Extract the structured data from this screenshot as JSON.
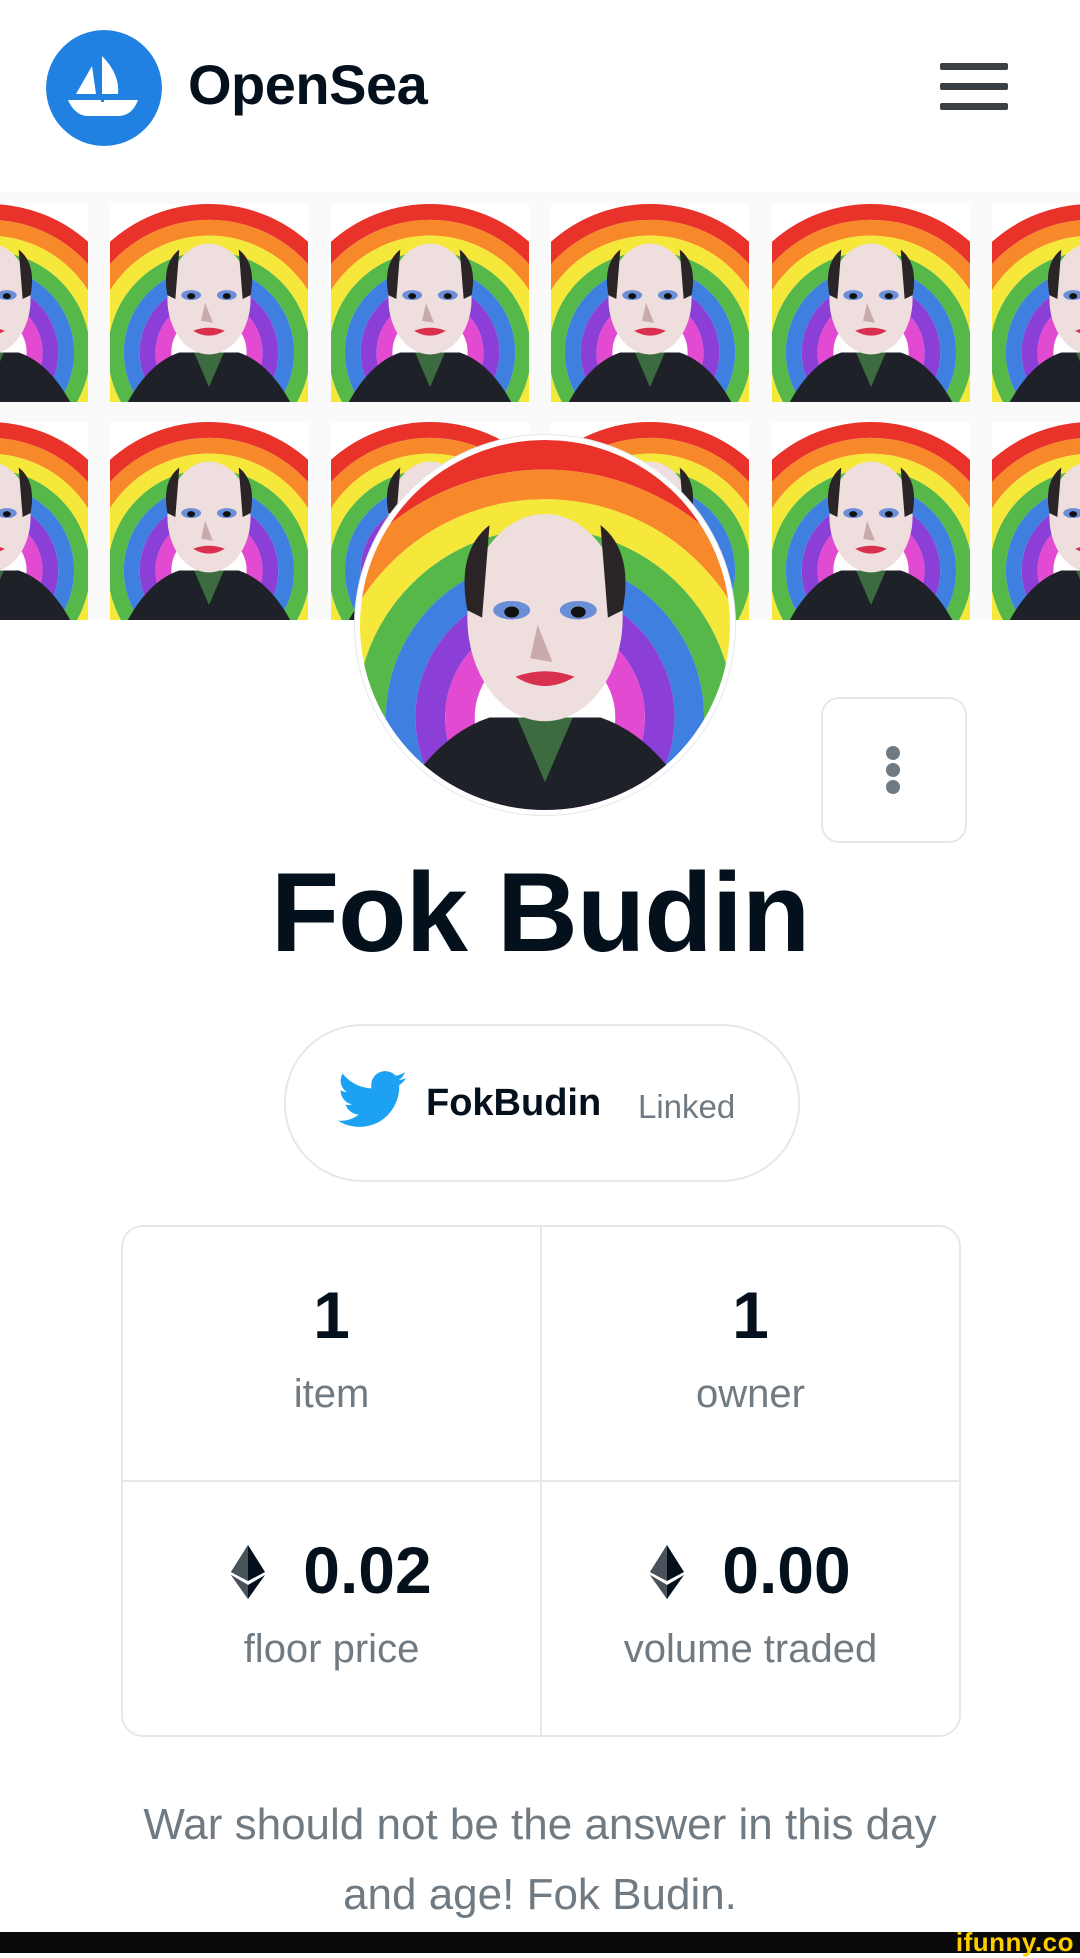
{
  "header": {
    "brand": "OpenSea",
    "logo_icon": "opensea-ship-icon",
    "menu_icon": "hamburger-menu-icon"
  },
  "profile": {
    "name": "Fok Budin",
    "more_icon": "more-vertical-icon",
    "twitter": {
      "icon": "twitter-bird-icon",
      "handle": "FokBudin",
      "status": "Linked"
    }
  },
  "stats": [
    {
      "value": "1",
      "label": "item",
      "eth": false
    },
    {
      "value": "1",
      "label": "owner",
      "eth": false
    },
    {
      "value": "0.02",
      "label": "floor price",
      "eth": true
    },
    {
      "value": "0.00",
      "label": "volume traded",
      "eth": true
    }
  ],
  "bio": {
    "line1": "War should not be the answer in this day",
    "line2": "and age! Fok Budin."
  },
  "watermark": "ifunny.co",
  "colors": {
    "brand_blue": "#2081e2",
    "text_dark": "#04111d",
    "text_gray": "#707a83",
    "border": "#e5e8eb",
    "twitter_blue": "#1da1f2"
  }
}
